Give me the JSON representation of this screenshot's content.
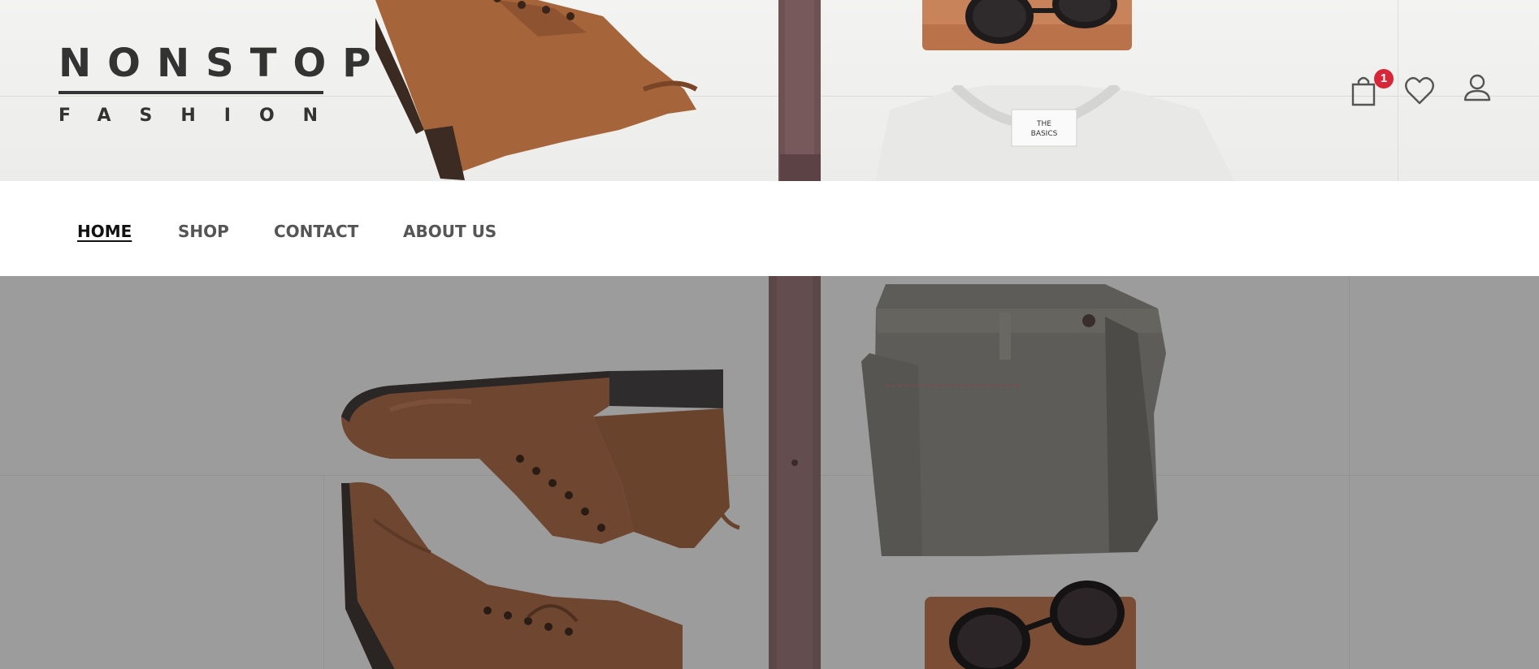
{
  "brand": {
    "name": "NONSTOP",
    "tagline": "FASHION"
  },
  "header_actions": {
    "cart_icon": "shopping-bag-icon",
    "cart_count": "1",
    "wishlist_icon": "heart-icon",
    "account_icon": "user-icon"
  },
  "nav": {
    "items": [
      {
        "label": "HOME",
        "active": true
      },
      {
        "label": "SHOP",
        "active": false
      },
      {
        "label": "CONTACT",
        "active": false
      },
      {
        "label": "ABOUT US",
        "active": false
      }
    ]
  },
  "colors": {
    "badge": "#d72638",
    "text_dark": "#333333",
    "nav_text": "#555555",
    "hero_overlay": "#9c9c9c"
  }
}
